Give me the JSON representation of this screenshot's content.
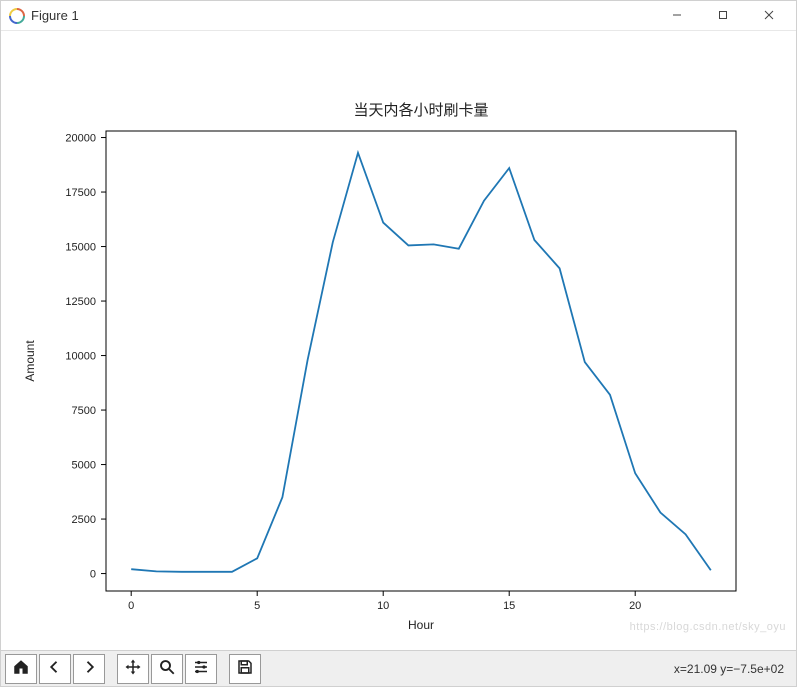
{
  "window": {
    "title": "Figure 1",
    "minimize_name": "minimize-icon",
    "maximize_name": "maximize-icon",
    "close_name": "close-icon"
  },
  "chart_data": {
    "type": "line",
    "title": "当天内各小时刷卡量",
    "xlabel": "Hour",
    "ylabel": "Amount",
    "x": [
      0,
      1,
      2,
      3,
      4,
      5,
      6,
      7,
      8,
      9,
      10,
      11,
      12,
      13,
      14,
      15,
      16,
      17,
      18,
      19,
      20,
      21,
      22,
      23
    ],
    "values": [
      200,
      100,
      80,
      80,
      80,
      700,
      3500,
      9800,
      15200,
      19300,
      16100,
      15050,
      15100,
      14900,
      17100,
      18600,
      15300,
      14000,
      9700,
      8200,
      4600,
      2800,
      1800,
      150
    ],
    "xticks": [
      0,
      5,
      10,
      15,
      20
    ],
    "yticks": [
      0,
      2500,
      5000,
      7500,
      10000,
      12500,
      15000,
      17500,
      20000
    ],
    "xlim": [
      -1,
      24
    ],
    "ylim": [
      -800,
      20300
    ],
    "line_color": "#1f77b4"
  },
  "toolbar": {
    "buttons": [
      {
        "name": "home-button",
        "icon": "home-icon"
      },
      {
        "name": "back-button",
        "icon": "arrow-left-icon"
      },
      {
        "name": "forward-button",
        "icon": "arrow-right-icon"
      }
    ],
    "buttons2": [
      {
        "name": "pan-button",
        "icon": "move-icon"
      },
      {
        "name": "zoom-button",
        "icon": "zoom-icon"
      },
      {
        "name": "configure-button",
        "icon": "sliders-icon"
      }
    ],
    "buttons3": [
      {
        "name": "save-button",
        "icon": "save-icon"
      }
    ],
    "status": "x=21.09 y=−7.5e+02"
  },
  "watermark": "https://blog.csdn.net/sky_oyu"
}
